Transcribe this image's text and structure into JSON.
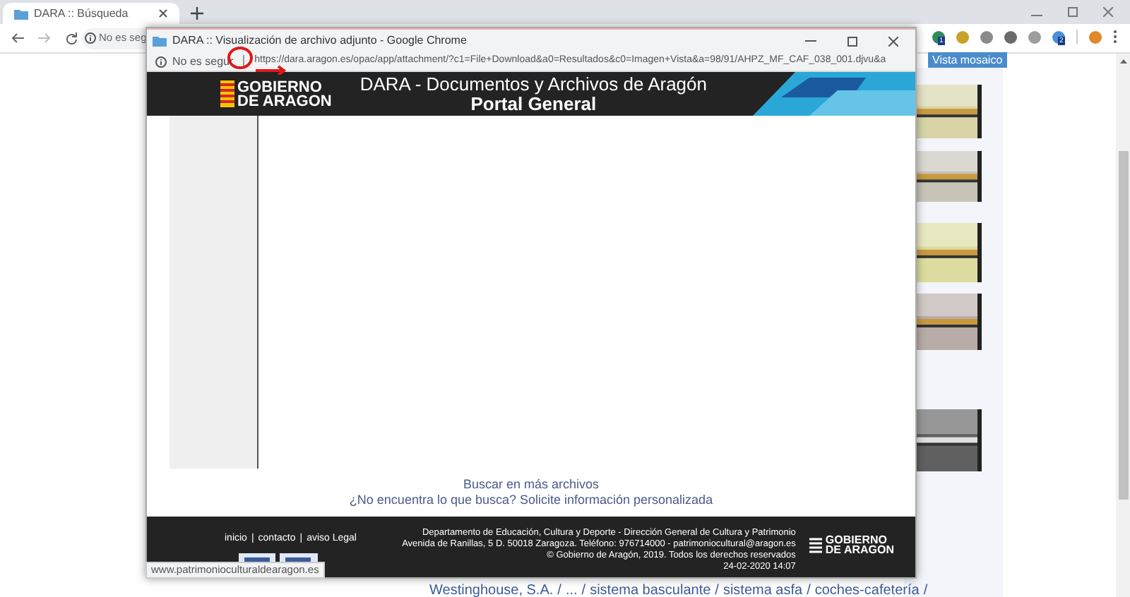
{
  "browser": {
    "tabs": [
      {
        "title": "DARA :: Búsqueda",
        "selected": true
      }
    ],
    "address": {
      "security": "No es seg"
    },
    "extensions": [
      {
        "color": "#2e8b57",
        "badge": "1"
      },
      {
        "color": "#c9a227"
      },
      {
        "color": "#8a8a8a"
      },
      {
        "color": "#6b6b6b"
      },
      {
        "color": "#9e9e9e"
      },
      {
        "color": "#4a90d9",
        "badge": "2"
      },
      {
        "color": "#e0882a"
      }
    ],
    "view_button": "Vista mosaico",
    "breadcrumb": {
      "items": [
        "Westinghouse, S.A.",
        "...",
        "sistema basculante",
        "sistema asfa",
        "coches-cafetería"
      ],
      "separator": "/"
    }
  },
  "popup": {
    "title": "DARA :: Visualización de archivo adjunto - Google Chrome",
    "security": "No es segur",
    "url": "https://dara.aragon.es/opac/app/attachment/?c1=File+Download&a0=Resultados&c0=Imagen+Vista&a=98/91/AHPZ_MF_CAF_038_001.djvu&a",
    "header": {
      "logo": [
        "GOBIERNO",
        "DE ARAGON"
      ],
      "title": "DARA - Documentos y Archivos de Aragón",
      "subtitle": "Portal General"
    },
    "links": [
      "Buscar en más archivos",
      "¿No encuentra lo que busca? Solicite información personalizada"
    ],
    "footer": {
      "nav": [
        "inicio",
        "contacto",
        "aviso Legal"
      ],
      "nav_separator": "|",
      "lines": [
        "Departamento de Educación, Cultura y Deporte - Dirección General de Cultura y Patrimonio",
        "Avenida de Ranillas, 5 D. 50018 Zaragoza. Teléfono: 976714000 - patrimoniocultural@aragon.es",
        "© Gobierno de Aragón, 2019. Todos los derechos reservados",
        "24-02-2020 14:07"
      ],
      "logo": [
        "GOBIERNO",
        "DE ARAGON"
      ]
    },
    "status": "www.patrimonioculturaldearagon.es"
  }
}
